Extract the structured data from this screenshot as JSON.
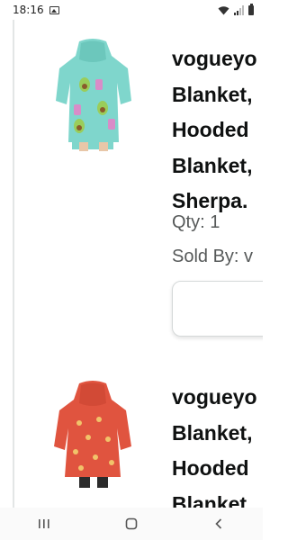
{
  "status_bar": {
    "time": "18:16",
    "icons": [
      "image-notification-icon",
      "wifi-icon",
      "cell-signal-icon",
      "battery-icon"
    ]
  },
  "orders": [
    {
      "title_lines": [
        "vogueyo",
        "Blanket,",
        "Hooded",
        "Blanket,",
        "Sherpa."
      ],
      "image": "teal-avocado-hoodie-blanket",
      "qty": "Qty: 1",
      "sold_by": "Sold By: v"
    },
    {
      "title_lines": [
        "vogueyo",
        "Blanket,",
        "Hooded",
        "Blanket"
      ],
      "image": "red-fox-hoodie-blanket"
    }
  ],
  "nav": [
    "recent-apps-icon",
    "home-icon",
    "back-icon"
  ],
  "colors": {
    "text": "#0f1111",
    "secondary_text": "#565959",
    "divider": "#e3e6e6"
  }
}
